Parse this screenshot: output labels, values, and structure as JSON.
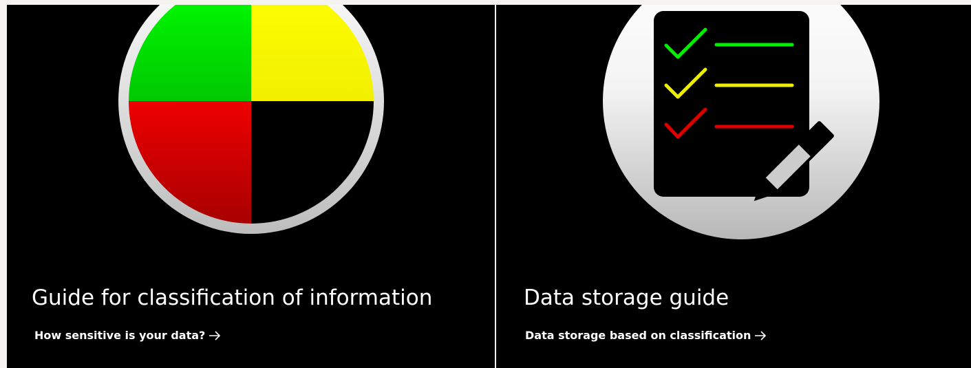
{
  "cards": [
    {
      "title": "Guide for classification of information",
      "link_label": "How sensitive is your data?",
      "icon": "classification-quadrant-icon",
      "colors": {
        "green": "#00dd00",
        "yellow": "#ffff00",
        "red": "#dd0000",
        "black": "#000000",
        "ring": "#e0e0e0"
      }
    },
    {
      "title": "Data storage guide",
      "link_label": "Data storage based on classification",
      "icon": "checklist-pencil-icon",
      "colors": {
        "green": "#00ee00",
        "yellow": "#eeee00",
        "red": "#dd0000",
        "badge": "#ffffff",
        "clipboard": "#000000"
      }
    }
  ],
  "arrow_icon": "arrow-right-icon",
  "colors": {
    "card_background": "#000000",
    "text": "#ffffff",
    "page_background": "#f5f3ef"
  }
}
